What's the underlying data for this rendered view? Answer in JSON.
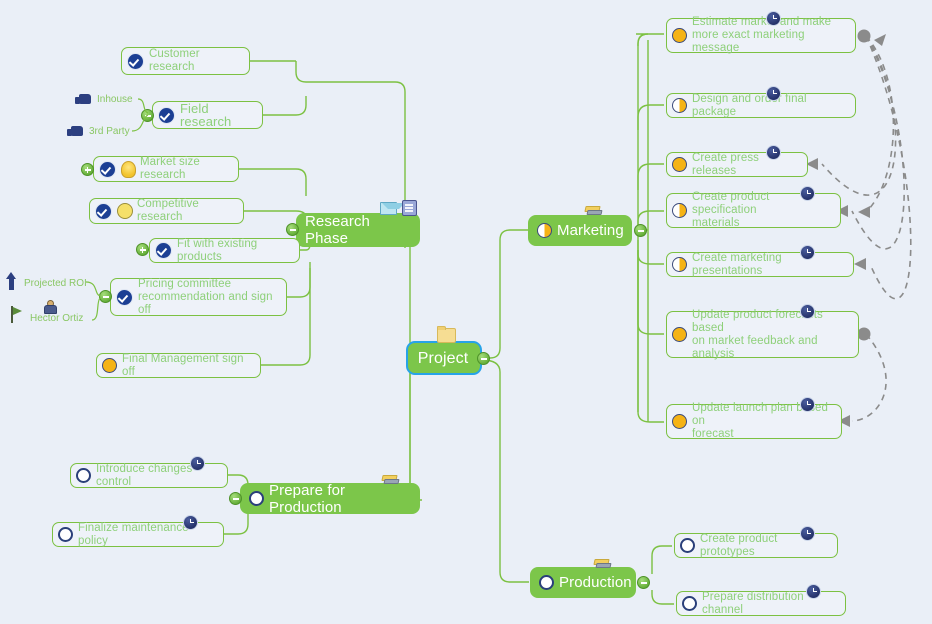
{
  "app": {
    "type": "mind-map",
    "background": "#eaeff7",
    "accent": "#7cc64a",
    "selection": "#27a3e8"
  },
  "root": {
    "label": "Project",
    "icon": "folder-icon",
    "selected": true
  },
  "branches": {
    "research": {
      "label": "Research Phase",
      "icons": [
        "mail-icon",
        "note-icon"
      ],
      "children": [
        {
          "label": "Customer research",
          "status": "check"
        },
        {
          "label": "Field research",
          "status": "check",
          "callouts": [
            {
              "label": "Inhouse",
              "icon": "thumbs-up-icon"
            },
            {
              "label": "3rd Party",
              "icon": "thumbs-up-icon"
            }
          ],
          "toggle": "minus"
        },
        {
          "label": "Market size research",
          "status": "check",
          "extra_icon": "lightbulb-icon",
          "toggle": "plus"
        },
        {
          "label": "Competitive research",
          "status": "check",
          "extra_icon": "smiley-icon"
        },
        {
          "label": "Fit with existing products",
          "status": "check",
          "toggle": "plus"
        },
        {
          "label": "Pricing committee\nrecommendation and sign off",
          "status": "check",
          "toggle": "minus",
          "callouts": [
            {
              "label": "Projected ROI",
              "icon": "up-arrow-icon"
            },
            {
              "label": "Hector Ortiz",
              "icon": "flag-icon"
            }
          ]
        },
        {
          "label": "Final Management sign off",
          "status": "pie-full"
        }
      ]
    },
    "marketing": {
      "label": "Marketing",
      "status": "pie-half",
      "icons": [
        "pencil-icon"
      ],
      "children": [
        {
          "label": "Estimate market and make\nmore exact marketing message",
          "status": "pie-full",
          "clock": true
        },
        {
          "label": "Design and order final package",
          "status": "pie-half",
          "clock": true
        },
        {
          "label": "Create press releases",
          "status": "pie-full",
          "clock": true
        },
        {
          "label": "Create product specification\nmaterials",
          "status": "pie-half",
          "clock": true
        },
        {
          "label": "Create marketing presentations",
          "status": "pie-half",
          "clock": true
        },
        {
          "label": "Update product forecasts based\non market feedback and\nanalysis",
          "status": "pie-full",
          "clock": true
        },
        {
          "label": "Update launch plan based on\nforecast",
          "status": "pie-full",
          "clock": true
        }
      ]
    },
    "prepare": {
      "label": "Prepare for Production",
      "status": "empty",
      "icons": [
        "pencil-icon"
      ],
      "children": [
        {
          "label": "Introduce changes control",
          "status": "empty",
          "clock": true
        },
        {
          "label": "Finalize maintenance policy",
          "status": "empty",
          "clock": true
        }
      ]
    },
    "production": {
      "label": "Production",
      "status": "empty",
      "icons": [
        "pencil-icon"
      ],
      "children": [
        {
          "label": "Create product prototypes",
          "status": "empty",
          "clock": true
        },
        {
          "label": "Prepare distribution channel",
          "status": "empty",
          "clock": true
        }
      ]
    }
  },
  "relationships": [
    {
      "from": "Design and order final package",
      "to": "Estimate market and make more exact marketing message"
    },
    {
      "from": "Create press releases",
      "to": "Estimate market and make more exact marketing message"
    },
    {
      "from": "Create product specification materials",
      "to": "Estimate market and make more exact marketing message"
    },
    {
      "from": "Create marketing presentations",
      "to": "Estimate market and make more exact marketing message"
    },
    {
      "from": "Update launch plan based on forecast",
      "to": "Update product forecasts based on market feedback and analysis"
    }
  ]
}
